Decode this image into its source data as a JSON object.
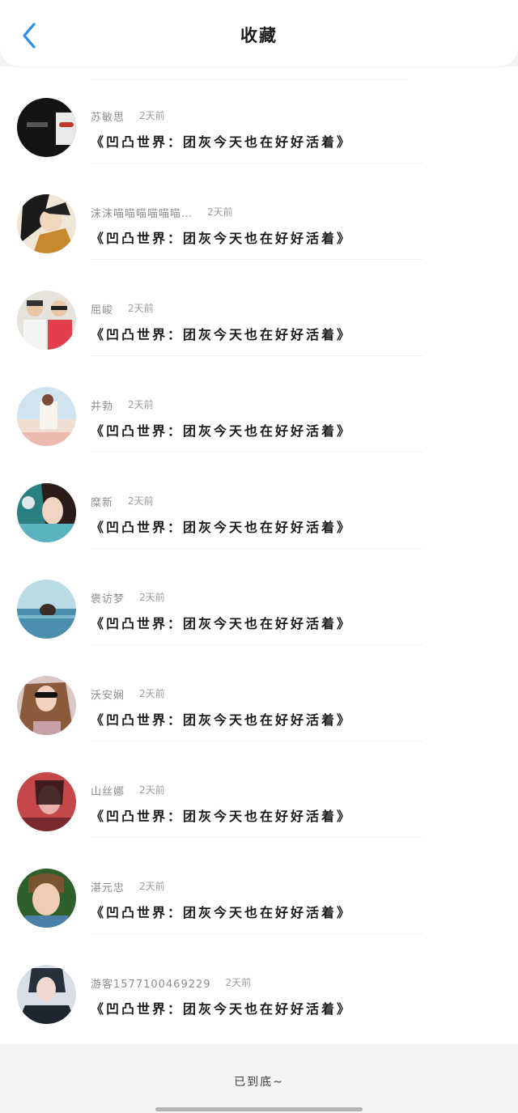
{
  "header": {
    "title": "收藏",
    "back_icon": "chevron-left-icon",
    "accent_color": "#2d8cf0"
  },
  "items": [
    {
      "username": "苏敏思",
      "time": "2天前",
      "title": "《凹凸世界：团灰今天也在好好活着》"
    },
    {
      "username": "沫沫喵喵喵喵喵喵…",
      "time": "2天前",
      "title": "《凹凸世界：团灰今天也在好好活着》"
    },
    {
      "username": "屈峻",
      "time": "2天前",
      "title": "《凹凸世界：团灰今天也在好好活着》"
    },
    {
      "username": "井勃",
      "time": "2天前",
      "title": "《凹凸世界：团灰今天也在好好活着》"
    },
    {
      "username": "糜新",
      "time": "2天前",
      "title": "《凹凸世界：团灰今天也在好好活着》"
    },
    {
      "username": "褒访梦",
      "time": "2天前",
      "title": "《凹凸世界：团灰今天也在好好活着》"
    },
    {
      "username": "沃安娴",
      "time": "2天前",
      "title": "《凹凸世界：团灰今天也在好好活着》"
    },
    {
      "username": "山丝娜",
      "time": "2天前",
      "title": "《凹凸世界：团灰今天也在好好活着》"
    },
    {
      "username": "湛元忠",
      "time": "2天前",
      "title": "《凹凸世界：团灰今天也在好好活着》"
    },
    {
      "username": "游客1577100469229",
      "time": "2天前",
      "title": "《凹凸世界：团灰今天也在好好活着》"
    }
  ],
  "footer": {
    "end_text": "已到底~"
  }
}
